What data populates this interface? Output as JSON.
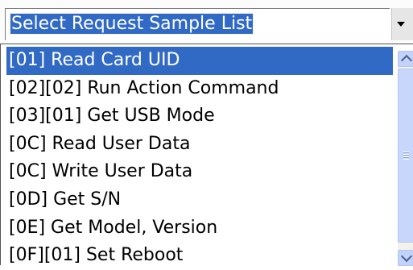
{
  "combo": {
    "selected_text": "Select Request Sample List",
    "dropdown_icon": "chevron-down-icon"
  },
  "list": {
    "items": [
      {
        "label": "[01] Read Card UID",
        "selected": true
      },
      {
        "label": "[02][02] Run Action Command",
        "selected": false
      },
      {
        "label": "[03][01] Get USB Mode",
        "selected": false
      },
      {
        "label": "[0C] Read User Data",
        "selected": false
      },
      {
        "label": "[0C] Write User Data",
        "selected": false
      },
      {
        "label": "[0D] Get S/N",
        "selected": false
      },
      {
        "label": "[0E] Get Model, Version",
        "selected": false
      },
      {
        "label": "[0F][01] Set Reboot",
        "selected": false
      }
    ],
    "scroll_position": 0
  },
  "colors": {
    "selection": "#316ac5",
    "scrollbar": "#c1d3fb"
  }
}
